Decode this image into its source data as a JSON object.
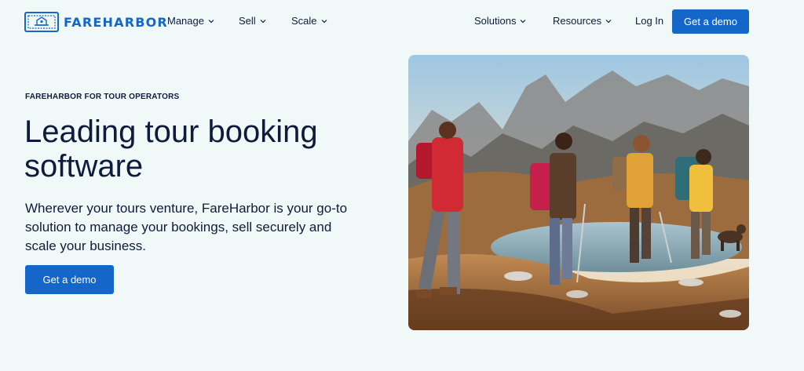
{
  "brand": {
    "name": "FAREHARBOR",
    "color": "#1466c8"
  },
  "nav": {
    "left": [
      {
        "label": "Manage"
      },
      {
        "label": "Sell"
      },
      {
        "label": "Scale"
      }
    ],
    "right": [
      {
        "label": "Solutions"
      },
      {
        "label": "Resources"
      }
    ],
    "login": "Log In",
    "cta": "Get a demo"
  },
  "hero": {
    "eyebrow": "FAREHARBOR FOR TOUR OPERATORS",
    "headline": "Leading tour booking software",
    "subtext": "Wherever your tours venture, FareHarbor is your go-to solution to manage your bookings, sell securely and scale your business.",
    "cta": "Get a demo",
    "image_icon": "hikers-photo"
  }
}
